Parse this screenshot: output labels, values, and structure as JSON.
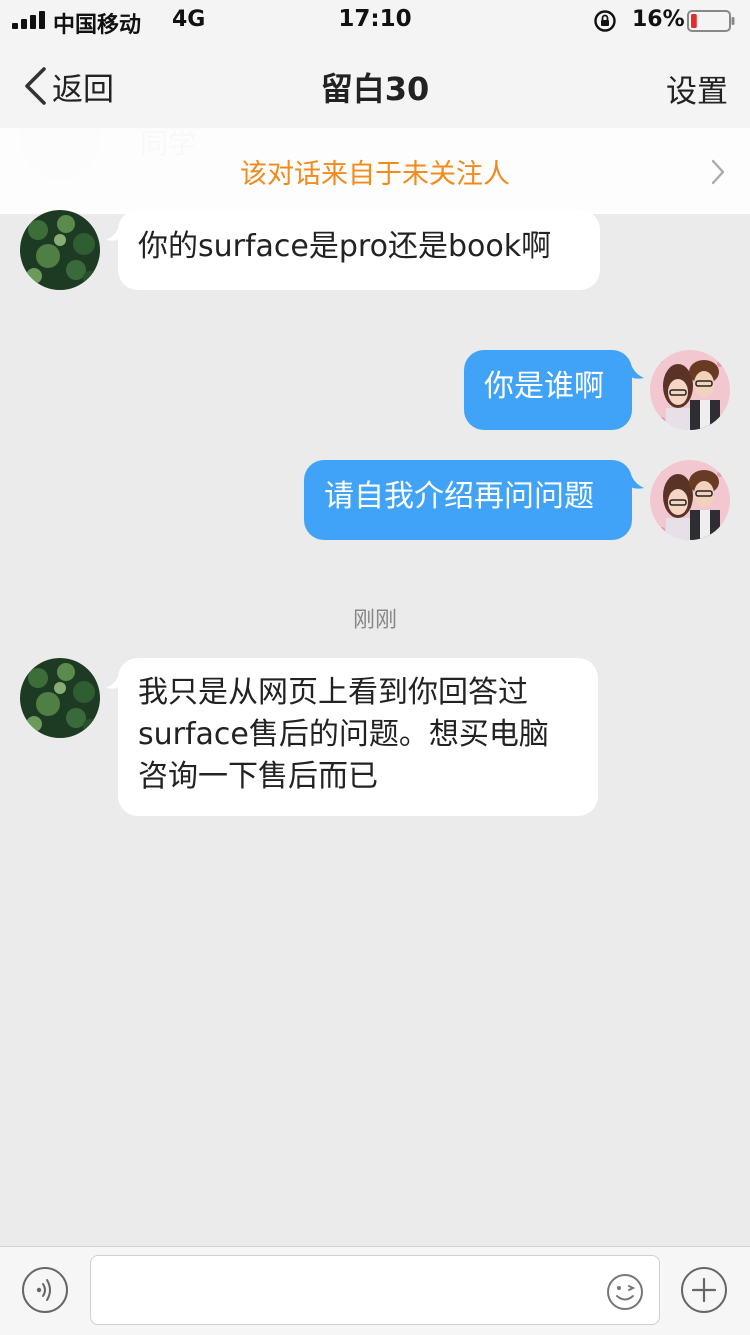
{
  "status_bar": {
    "carrier": "中国移动",
    "network": "4G",
    "time": "17:10",
    "battery": "16%",
    "battery_level": 0.16
  },
  "nav": {
    "back_label": "返回",
    "title": "留白30",
    "settings_label": "设置"
  },
  "ghost_name": "同学",
  "notice": "该对话来自于未关注人",
  "messages": [
    {
      "side": "in",
      "text": "你的surface是pro还是book啊"
    },
    {
      "side": "out",
      "text": "你是谁啊"
    },
    {
      "side": "out",
      "text": "请自我介绍再问问题"
    },
    {
      "side": "in",
      "text": "我只是从网页上看到你回答过surface售后的问题。想买电脑咨询一下售后而已"
    }
  ],
  "timestamp": "刚刚",
  "input": {
    "value": "",
    "placeholder": ""
  },
  "colors": {
    "accent_bubble": "#41a3f7",
    "notice_text": "#f28a1c",
    "background": "#ebebeb"
  },
  "icons": [
    "signal-icon",
    "lock-rotation-icon",
    "battery-icon",
    "chevron-left-icon",
    "chevron-right-icon",
    "voice-icon",
    "emoji-icon",
    "plus-icon"
  ]
}
